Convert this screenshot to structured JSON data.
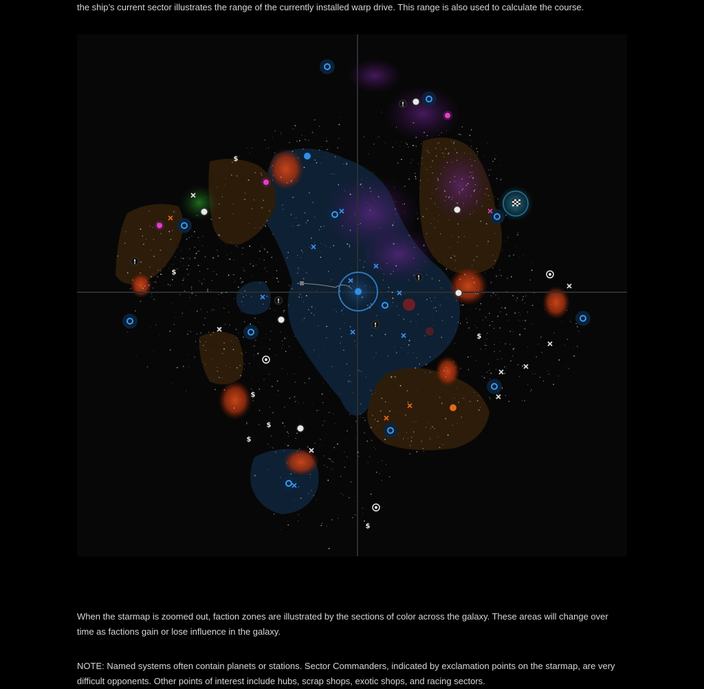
{
  "text": {
    "intro": "the ship’s current sector illustrates the range of the currently installed warp drive. This range is also used to calculate the course.",
    "faction_zones": "When the starmap is zoomed out, faction zones are illustrated by the sections of color across the galaxy. These areas will change over time as factions gain or lose influence in the galaxy.",
    "note": "NOTE: Named systems often contain planets or stations. Sector Commanders, indicated by exclamation points on the starmap, are very difficult opponents. Other points of interest include hubs, scrap shops, exotic shops, and racing sectors."
  },
  "starmap": {
    "icons": {
      "commander": "!",
      "scrap_shop": "$",
      "hub": "hub-icon",
      "racing": "checkered-flag-icon",
      "station": "station-icon",
      "named_system": "cross-icon"
    },
    "colors": {
      "background": "#070707",
      "crosshair": "#2a2e33",
      "blue_zone": "#0f2236",
      "orange_zone": "#2e1d0a",
      "purple_nebula": "#6a1f8a",
      "green_nebula": "#1d6b1d",
      "red_nebula": "#b23a16",
      "ship": "#2f8fe8",
      "magenta_planet": "#e040c8",
      "orange_marker": "#e06a1a"
    }
  }
}
